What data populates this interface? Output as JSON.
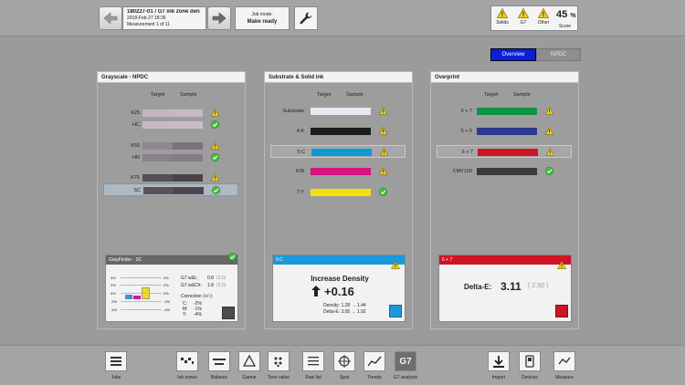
{
  "header": {
    "job_title": "180227-01 / G7 ink zone den",
    "job_date": "2018-Feb-27 18:36",
    "measurement": "Measurement 1 of 11",
    "job_mode_label": "Job mode:",
    "job_mode_value": "Make ready",
    "score_items": [
      {
        "label": "Solids"
      },
      {
        "label": "G7"
      },
      {
        "label": "Other"
      }
    ],
    "score_value": "45",
    "score_unit": "%",
    "score_label": "Score"
  },
  "view_toggle": {
    "overview": "Overview",
    "npdc": "NPDC"
  },
  "panels": {
    "grayscale": {
      "title": "Grayscale - NPDC",
      "col_target": "Target",
      "col_sample": "Sample",
      "rows": [
        {
          "label": "K25",
          "status": "warning",
          "target": "#c4b7c2",
          "sample": "#c6bac5"
        },
        {
          "label": "HC",
          "status": "ok",
          "target": "#c7bac5",
          "sample": "#c9bcc7"
        },
        {
          "label": "K50",
          "status": "warning",
          "target": "#918590",
          "sample": "#7c727b"
        },
        {
          "label": "HR",
          "status": "ok",
          "target": "#8c808b",
          "sample": "#877b86"
        },
        {
          "label": "K75",
          "status": "warning",
          "target": "#564e55",
          "sample": "#4a4249"
        },
        {
          "label": "SC",
          "status": "ok",
          "target": "#5a525a",
          "sample": "#4e464e"
        }
      ],
      "detail": {
        "title": "GrayFinder - SC",
        "scale_labels": [
          "4%",
          "2%",
          "0%",
          "-2%",
          "-4%"
        ],
        "scale_labels_right": [
          "4%",
          "2%",
          "0%",
          "-2%",
          "-4%"
        ],
        "g7_wdl_label": "G7 wΔL:",
        "g7_wdl_value": "0.8",
        "g7_wdl_tol": "(3.0)",
        "g7_wdch_label": "G7 wΔCh:",
        "g7_wdch_value": "1.8",
        "g7_wdch_tol": "(3.0)",
        "correction_label": "Correction (+/-):",
        "corrections": [
          {
            "ch": "C:",
            "val": "-2%"
          },
          {
            "ch": "M:",
            "val": "-1%"
          },
          {
            "ch": "Y:",
            "val": "-4%"
          }
        ]
      }
    },
    "substrate": {
      "title": "Substrate & Solid ink",
      "col_target": "Target",
      "col_sample": "Sample",
      "rows": [
        {
          "label": "Substrate",
          "status": "warning",
          "color": "#efe6f4"
        },
        {
          "label": "4:K",
          "status": "warning",
          "color": "#1c1c1e"
        },
        {
          "label": "5:C",
          "status": "warning",
          "color": "#0a9ad6"
        },
        {
          "label": "6:M",
          "status": "warning",
          "color": "#d5157f"
        },
        {
          "label": "7:Y",
          "status": "ok",
          "color": "#f2e20c"
        }
      ],
      "detail": {
        "title": "5:C",
        "heading": "Increase Density",
        "delta": "+0.16",
        "density_line": "Density: 1.28 → 1.44",
        "deltae_line": "Delta-E: 3.05 → 1.92",
        "swatch": "#0a9ad6"
      }
    },
    "overprint": {
      "title": "Overprint",
      "col_target": "Target",
      "col_sample": "Sample",
      "rows": [
        {
          "label": "5 + 7",
          "status": "warning",
          "color": "#0f9345"
        },
        {
          "label": "5 + 6",
          "status": "warning",
          "color": "#2d3a8f"
        },
        {
          "label": "6 + 7",
          "status": "warning",
          "color": "#cf1426"
        },
        {
          "label": "CMY100",
          "status": "ok",
          "color": "#3a3a3c"
        }
      ],
      "detail": {
        "title": "6 + 7",
        "label": "Delta-E:",
        "value": "3.11",
        "tolerance": "( 2.50 )",
        "swatch": "#cf1426"
      }
    }
  },
  "toolbar": {
    "left": [
      {
        "label": "Jobs"
      }
    ],
    "middle": [
      {
        "label": "Ink zones"
      },
      {
        "label": "Balance"
      },
      {
        "label": "Gamut"
      },
      {
        "label": "Tone value"
      },
      {
        "label": "Raw list"
      },
      {
        "label": "Spot"
      },
      {
        "label": "Trends"
      },
      {
        "label": "G7 analysis",
        "icon_text": "G7"
      }
    ],
    "right": [
      {
        "label": "Import"
      },
      {
        "label": "Devices"
      },
      {
        "label": "Measure"
      }
    ]
  },
  "colors": {
    "accent_blue": "#0b1fd8",
    "warning_yellow": "#f2d21c",
    "ok_green": "#3fbf3f",
    "cyan_bar": "#1a9ad8",
    "red_bar": "#cf1426"
  }
}
